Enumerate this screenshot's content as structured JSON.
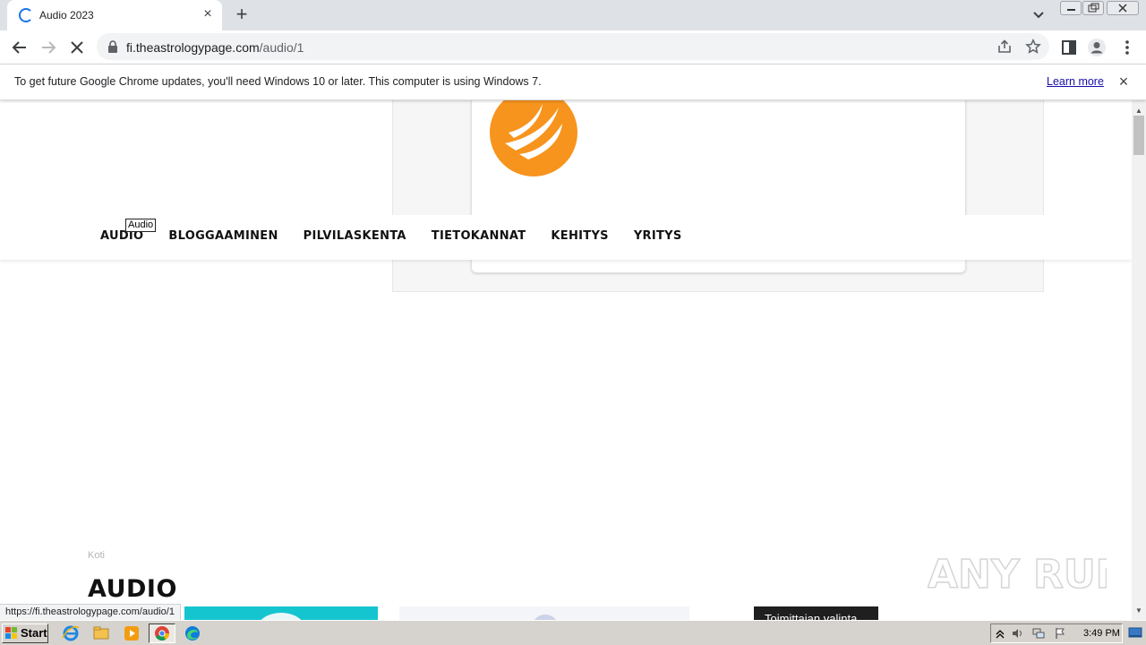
{
  "browser": {
    "tab_title": "Audio 2023",
    "url_host": "fi.theastrologypage.com",
    "url_path": "/audio/1",
    "status_url": "https://fi.theastrologypage.com/audio/1"
  },
  "infobar": {
    "message": "To get future Google Chrome updates, you'll need Windows 10 or later. This computer is using Windows 7.",
    "link": "Learn more"
  },
  "nav": {
    "tooltip": "Audio",
    "items": [
      {
        "label": "AUDIO"
      },
      {
        "label": "BLOGGAAMINEN"
      },
      {
        "label": "PILVILASKENTA"
      },
      {
        "label": "TIETOKANNAT"
      },
      {
        "label": "KEHITYS"
      },
      {
        "label": "YRITYS"
      }
    ]
  },
  "content": {
    "breadcrumb": "Koti",
    "heading": "AUDIO",
    "editor_badge": "Toimittajan valinta"
  },
  "watermark": "ANY RUN",
  "taskbar": {
    "start_label": "Start",
    "clock": "3:49 PM"
  },
  "colors": {
    "accent": "#1a73e8",
    "logo": "#f7941d",
    "thumb": "#14c5d0"
  }
}
